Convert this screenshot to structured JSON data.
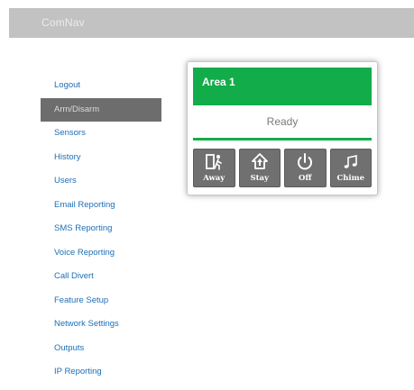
{
  "header": {
    "brand": "ComNav"
  },
  "sidebar": {
    "items": [
      {
        "label": "Logout",
        "active": false
      },
      {
        "label": "Arm/Disarm",
        "active": true
      },
      {
        "label": "Sensors",
        "active": false
      },
      {
        "label": "History",
        "active": false
      },
      {
        "label": "Users",
        "active": false
      },
      {
        "label": "Email Reporting",
        "active": false
      },
      {
        "label": "SMS Reporting",
        "active": false
      },
      {
        "label": "Voice Reporting",
        "active": false
      },
      {
        "label": "Call Divert",
        "active": false
      },
      {
        "label": "Feature Setup",
        "active": false
      },
      {
        "label": "Network Settings",
        "active": false
      },
      {
        "label": "Outputs",
        "active": false
      },
      {
        "label": "IP Reporting",
        "active": false
      }
    ]
  },
  "area": {
    "title": "Area 1",
    "status": "Ready",
    "buttons": [
      {
        "label": "Away",
        "icon": "away-icon"
      },
      {
        "label": "Stay",
        "icon": "stay-icon"
      },
      {
        "label": "Off",
        "icon": "power-icon"
      },
      {
        "label": "Chime",
        "icon": "chime-icon"
      }
    ]
  },
  "colors": {
    "header_bg": "#c2c2c2",
    "area_green": "#13ac4a",
    "button_gray": "#707070",
    "nav_active_bg": "#6d6d6d",
    "link_blue": "#1c6fb6"
  }
}
